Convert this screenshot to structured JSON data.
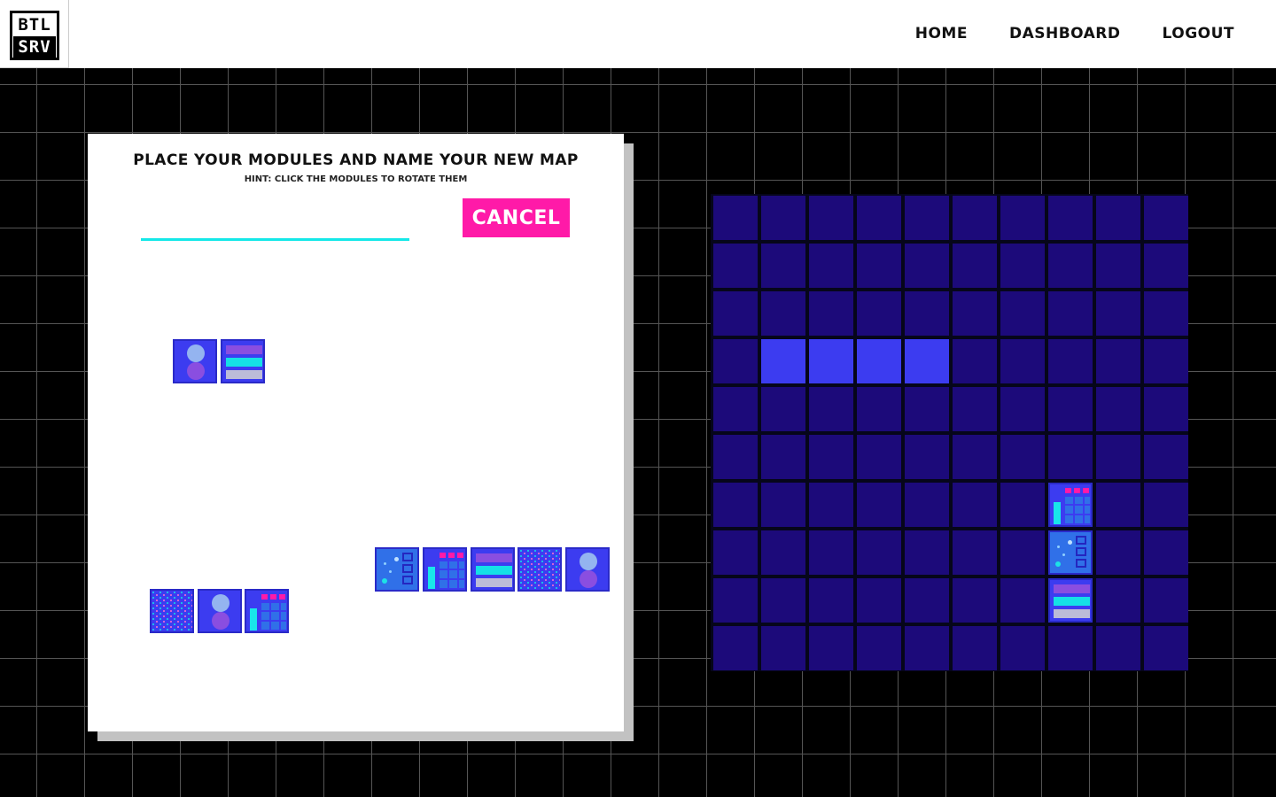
{
  "logo": {
    "line1": "BTL",
    "line2": "SRV"
  },
  "nav": {
    "home": "HOME",
    "dashboard": "DASHBOARD",
    "logout": "LOGOUT"
  },
  "panel": {
    "title": "PLACE YOUR MODULES AND NAME YOUR NEW MAP",
    "hint": "HINT: CLICK THE MODULES TO ROTATE THEM",
    "map_name_value": "",
    "cancel_label": "CANCEL"
  },
  "colors": {
    "accent_pink": "#ff1aa8",
    "accent_cyan": "#14e8e8",
    "board_cell": "#1c0a7a",
    "module": "#3c3cf0"
  },
  "available_modules": [
    {
      "group": "top-left",
      "icons": [
        "capsule-module-icon",
        "stripe-module-icon"
      ]
    },
    {
      "group": "bottom-left",
      "icons": [
        "dot-grid-module-icon",
        "capsule-module-icon",
        "tank-module-icon"
      ]
    },
    {
      "group": "bottom-right",
      "icons": [
        "panel-module-icon",
        "tank-module-icon",
        "stripe-module-icon",
        "dot-grid-module-icon",
        "capsule-module-icon"
      ]
    }
  ],
  "board": {
    "rows": 10,
    "cols": 10,
    "placed_modules": [
      {
        "row": 4,
        "col": 2,
        "icon": "dot-grid-module-icon"
      },
      {
        "row": 4,
        "col": 3,
        "icon": "dot-grid-module-icon"
      },
      {
        "row": 4,
        "col": 4,
        "icon": "dot-grid-module-icon"
      },
      {
        "row": 4,
        "col": 5,
        "icon": "dot-grid-module-icon"
      },
      {
        "row": 7,
        "col": 8,
        "icon": "tank-module-icon"
      },
      {
        "row": 8,
        "col": 8,
        "icon": "panel-module-icon"
      },
      {
        "row": 9,
        "col": 8,
        "icon": "stripe-module-icon"
      }
    ]
  }
}
